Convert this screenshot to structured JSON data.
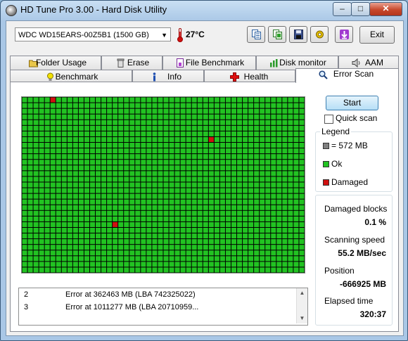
{
  "window": {
    "title": "HD Tune Pro 3.00 - Hard Disk Utility",
    "controls": {
      "minimize": "–",
      "maximize": "□",
      "close": "✕"
    }
  },
  "toolbar": {
    "drive": "WDC WD15EARS-00Z5B1 (1500 GB)",
    "temperature": "27°C",
    "exit_label": "Exit",
    "icons": [
      "copy-text-icon",
      "copy-screenshot-icon",
      "save-icon",
      "options-icon",
      "download-icon"
    ]
  },
  "tabs": {
    "back_row": [
      {
        "label": "Folder Usage",
        "icon": "folder-icon"
      },
      {
        "label": "Erase",
        "icon": "trash-icon"
      },
      {
        "label": "File Benchmark",
        "icon": "file-benchmark-icon"
      },
      {
        "label": "Disk monitor",
        "icon": "disk-monitor-icon"
      },
      {
        "label": "AAM",
        "icon": "speaker-icon"
      }
    ],
    "front_row": [
      {
        "label": "Benchmark",
        "icon": "lightbulb-icon"
      },
      {
        "label": "Info",
        "icon": "info-icon"
      },
      {
        "label": "Health",
        "icon": "health-cross-icon"
      },
      {
        "label": "Error Scan",
        "icon": "magnifier-icon"
      }
    ]
  },
  "scan": {
    "start_label": "Start",
    "quick_scan_label": "Quick scan",
    "quick_scan_checked": false,
    "legend_title": "Legend",
    "legend": [
      {
        "label": "= 572 MB",
        "color": "#808080"
      },
      {
        "label": "Ok",
        "color": "#22c322"
      },
      {
        "label": "Damaged",
        "color": "#d01010"
      }
    ],
    "stats": [
      {
        "label": "Damaged blocks",
        "value": "0.1 %"
      },
      {
        "label": "Scanning speed",
        "value": "55.2 MB/sec"
      },
      {
        "label": "Position",
        "value": "-666925 MB"
      },
      {
        "label": "Elapsed time",
        "value": "320:37"
      }
    ],
    "grid": {
      "cols": 50,
      "rows": 31,
      "ok_color": "#22c322",
      "damaged_color": "#d01010",
      "damaged_cells": [
        [
          5,
          0
        ],
        [
          33,
          7
        ],
        [
          16,
          22
        ]
      ]
    },
    "log": [
      {
        "n": "2",
        "text": "Error at 362463 MB (LBA 742325022)"
      },
      {
        "n": "3",
        "text": "Error at 1011277 MB (LBA 20710959..."
      }
    ]
  }
}
